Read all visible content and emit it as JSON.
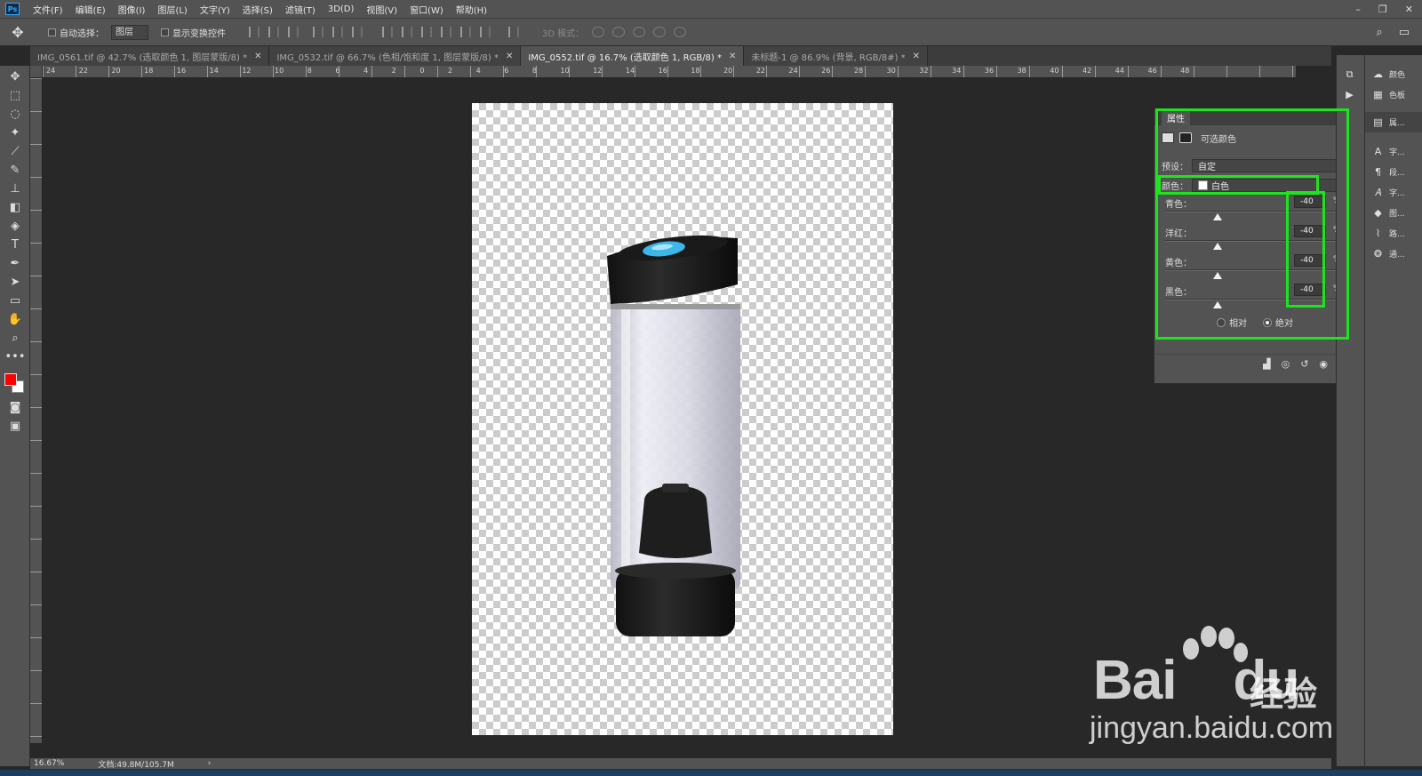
{
  "menu": {
    "items": [
      "文件(F)",
      "编辑(E)",
      "图像(I)",
      "图层(L)",
      "文字(Y)",
      "选择(S)",
      "滤镜(T)",
      "3D(D)",
      "视图(V)",
      "窗口(W)",
      "帮助(H)"
    ]
  },
  "optionsbar": {
    "auto_select_label": "自动选择：",
    "auto_select_value": "图层",
    "show_transform_label": "显示变换控件",
    "mode_3d_label": "3D 模式："
  },
  "tabs": [
    {
      "label": "IMG_0561.tif @ 42.7% (选取颜色 1, 图层蒙版/8) *"
    },
    {
      "label": "IMG_0532.tif @ 66.7% (色相/饱和度 1, 图层蒙版/8) *"
    },
    {
      "label": "IMG_0552.tif @ 16.7% (选取颜色 1, RGB/8) *"
    },
    {
      "label": "未标题-1 @ 86.9% (背景, RGB/8#) *"
    }
  ],
  "ruler": {
    "h_labels": "24 22 20 18 16 14 12 10 8 6 4 2 0 2 4 6 8 10 12 14 16 18 20 22 24 26 28 30 32 34 36 38 40 42 44 46 48"
  },
  "properties": {
    "tab_label": "属性",
    "adjustment_name": "可选颜色",
    "preset_label": "预设：",
    "preset_value": "自定",
    "color_label": "颜色：",
    "color_value": "白色",
    "sliders": [
      {
        "label": "青色：",
        "value": "-40",
        "unit": "%",
        "position": 0.3
      },
      {
        "label": "洋红：",
        "value": "-40",
        "unit": "%",
        "position": 0.3
      },
      {
        "label": "黄色：",
        "value": "-40",
        "unit": "%",
        "position": 0.3
      },
      {
        "label": "黑色：",
        "value": "-40",
        "unit": "%",
        "position": 0.3
      }
    ],
    "method_relative": "相对",
    "method_absolute": "绝对",
    "method_selected": "绝对"
  },
  "dock": {
    "wide_items": [
      {
        "label": "颜色",
        "icon": "color-icon"
      },
      {
        "label": "色板",
        "icon": "swatches-icon"
      },
      {
        "label": "属...",
        "icon": "properties-icon"
      },
      {
        "label": "字...",
        "icon": "character-icon"
      },
      {
        "label": "段...",
        "icon": "paragraph-icon"
      },
      {
        "label": "字...",
        "icon": "glyphs-icon"
      },
      {
        "label": "图...",
        "icon": "layers-icon"
      },
      {
        "label": "路...",
        "icon": "paths-icon"
      },
      {
        "label": "通...",
        "icon": "channels-icon"
      }
    ]
  },
  "status": {
    "zoom": "16.67%",
    "doc_size": "文档:49.8M/105.7M"
  },
  "watermark": {
    "brand": "Bai",
    "brand_suffix": "du",
    "cn": "经验",
    "url": "jingyan.baidu.com"
  },
  "colors": {
    "foreground": "#ff0000",
    "background": "#ffffff",
    "highlight": "#1de51d"
  }
}
